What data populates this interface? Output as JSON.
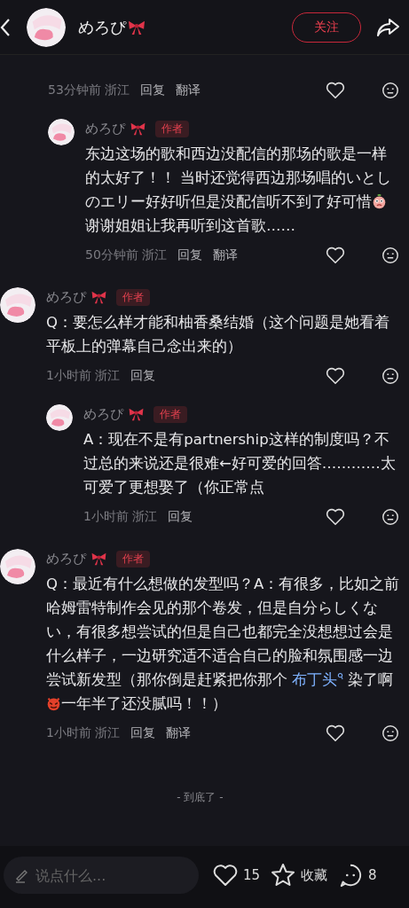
{
  "header": {
    "name": "めろぴ",
    "follow": "关注"
  },
  "comments": [
    {
      "time": "53分钟前 浙江",
      "actions": [
        "回复",
        "翻译"
      ],
      "children": [
        {
          "author": "めろぴ",
          "badge": "作者",
          "segments": [
            {
              "kind": "text",
              "text": "东边这场的歌和西边没配信的那场的歌是一样的太好了！！ 当时还觉得西边那场唱的いとしのエリー好好听但是没配信听不到了好可惜"
            },
            {
              "kind": "crying-emoji"
            },
            {
              "kind": "text",
              "text": "谢谢姐姐让我再听到这首歌……"
            }
          ],
          "time": "50分钟前 浙江",
          "actions": [
            "回复",
            "翻译"
          ]
        }
      ]
    },
    {
      "author": "めろぴ",
      "badge": "作者",
      "segments": [
        {
          "kind": "text",
          "text": "Q：要怎么样才能和柚香桑结婚（这个问题是她看着平板上的弹幕自己念出来的）"
        }
      ],
      "time": "1小时前 浙江",
      "actions": [
        "回复"
      ],
      "children": [
        {
          "author": "めろぴ",
          "badge": "作者",
          "segments": [
            {
              "kind": "text",
              "text": "A：现在不是有partnership这样的制度吗？不过总的来说还是很难←好可爱的回答…………太可爱了更想娶了（你正常点"
            }
          ],
          "time": "1小时前 浙江",
          "actions": [
            "回复"
          ]
        }
      ]
    },
    {
      "author": "めろぴ",
      "badge": "作者",
      "segments": [
        {
          "kind": "text",
          "text": "Q：最近有什么想做的发型吗？A：有很多，比如之前哈姆雷特制作会见的那个卷发，但是自分らしくない，有很多想尝试的但是自己也都完全没想想过会是什么样子，一边研究适不适合自己的脸和氛围感一边尝试新发型（那你倒是赶紧把你那个 "
        },
        {
          "kind": "link",
          "text": "布丁头"
        },
        {
          "kind": "text",
          "text": " 染了啊"
        },
        {
          "kind": "devil-emoji"
        },
        {
          "kind": "text",
          "text": "一年半了还没腻吗！！）"
        }
      ],
      "time": "1小时前 浙江",
      "actions": [
        "回复",
        "翻译"
      ]
    }
  ],
  "end_note": "- 到底了 -",
  "bottom_bar": {
    "placeholder": "说点什么...",
    "likes": "15",
    "favorite": "收藏",
    "comments": "8"
  }
}
